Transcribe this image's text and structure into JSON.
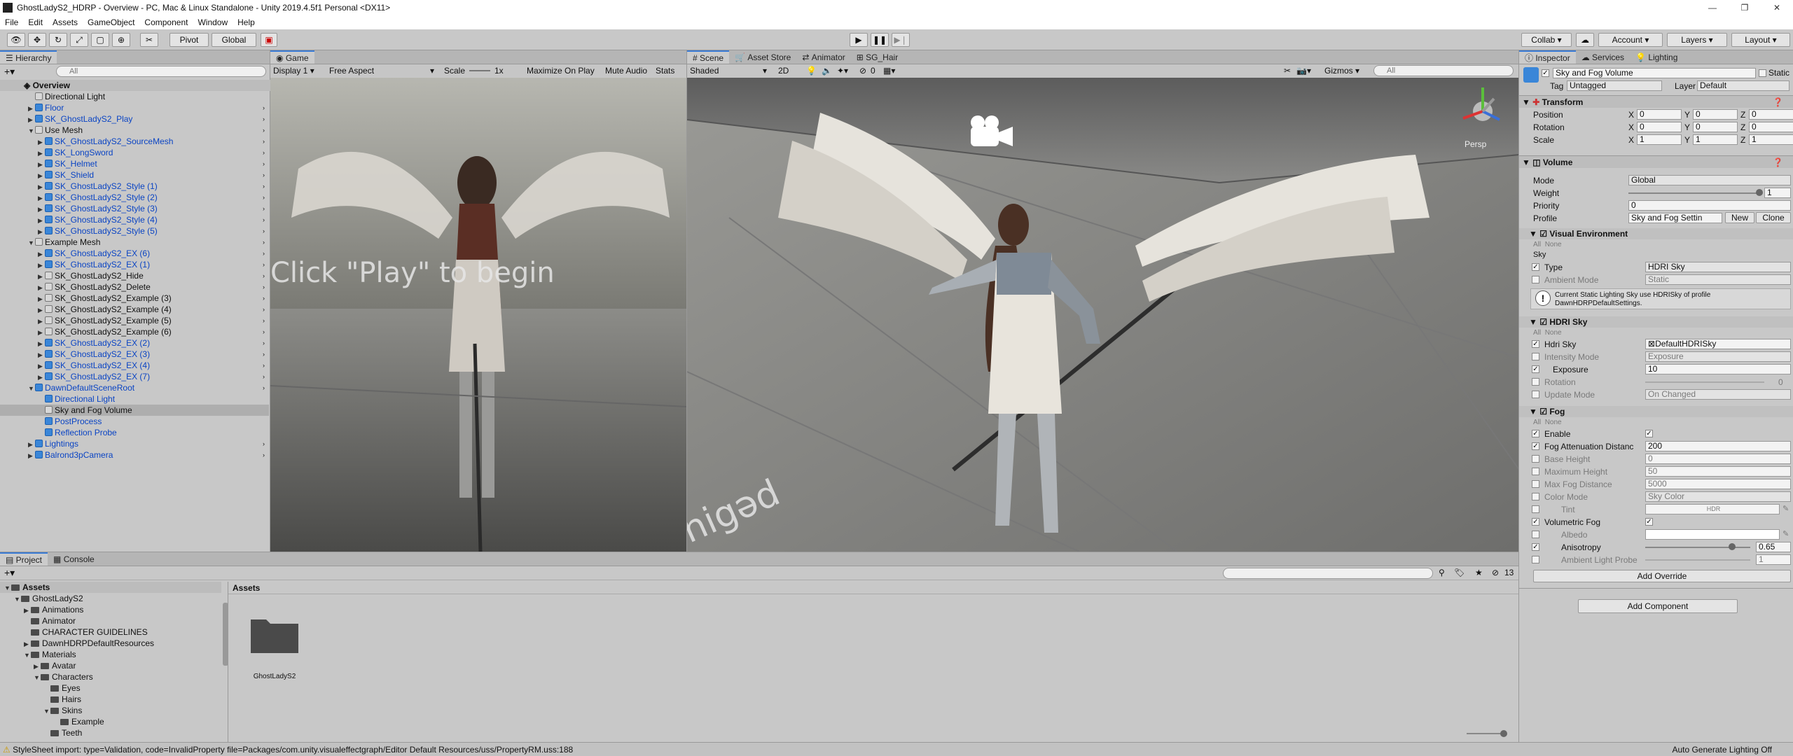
{
  "window": {
    "title": "GhostLadyS2_HDRP - Overview - PC, Mac & Linux Standalone - Unity 2019.4.5f1 Personal <DX11>"
  },
  "menu": [
    "File",
    "Edit",
    "Assets",
    "GameObject",
    "Component",
    "Window",
    "Help"
  ],
  "toolbar": {
    "pivot": "Pivot",
    "global": "Global",
    "collab": "Collab",
    "account": "Account",
    "layers": "Layers",
    "layout": "Layout"
  },
  "hierarchy": {
    "tab": "Hierarchy",
    "search_placeholder": "All",
    "scene": "Overview",
    "rows": [
      {
        "label": "Directional Light",
        "indent": 1,
        "arrow": "",
        "blue": false,
        "sel": false
      },
      {
        "label": "Floor",
        "indent": 1,
        "arrow": "▶",
        "blue": true,
        "sel": false
      },
      {
        "label": "SK_GhostLadyS2_Play",
        "indent": 1,
        "arrow": "▶",
        "blue": true,
        "sel": false
      },
      {
        "label": "Use Mesh",
        "indent": 1,
        "arrow": "▼",
        "blue": false,
        "sel": false
      },
      {
        "label": "SK_GhostLadyS2_SourceMesh",
        "indent": 2,
        "arrow": "▶",
        "blue": true,
        "sel": false
      },
      {
        "label": "SK_LongSword",
        "indent": 2,
        "arrow": "▶",
        "blue": true,
        "sel": false
      },
      {
        "label": "SK_Helmet",
        "indent": 2,
        "arrow": "▶",
        "blue": true,
        "sel": false
      },
      {
        "label": "SK_Shield",
        "indent": 2,
        "arrow": "▶",
        "blue": true,
        "sel": false
      },
      {
        "label": "SK_GhostLadyS2_Style (1)",
        "indent": 2,
        "arrow": "▶",
        "blue": true,
        "sel": false
      },
      {
        "label": "SK_GhostLadyS2_Style (2)",
        "indent": 2,
        "arrow": "▶",
        "blue": true,
        "sel": false
      },
      {
        "label": "SK_GhostLadyS2_Style (3)",
        "indent": 2,
        "arrow": "▶",
        "blue": true,
        "sel": false
      },
      {
        "label": "SK_GhostLadyS2_Style (4)",
        "indent": 2,
        "arrow": "▶",
        "blue": true,
        "sel": false
      },
      {
        "label": "SK_GhostLadyS2_Style (5)",
        "indent": 2,
        "arrow": "▶",
        "blue": true,
        "sel": false
      },
      {
        "label": "Example Mesh",
        "indent": 1,
        "arrow": "▼",
        "blue": false,
        "sel": false
      },
      {
        "label": "SK_GhostLadyS2_EX (6)",
        "indent": 2,
        "arrow": "▶",
        "blue": true,
        "sel": false
      },
      {
        "label": "SK_GhostLadyS2_EX (1)",
        "indent": 2,
        "arrow": "▶",
        "blue": true,
        "sel": false
      },
      {
        "label": "SK_GhostLadyS2_Hide",
        "indent": 2,
        "arrow": "▶",
        "blue": false,
        "sel": false
      },
      {
        "label": "SK_GhostLadyS2_Delete",
        "indent": 2,
        "arrow": "▶",
        "blue": false,
        "sel": false
      },
      {
        "label": "SK_GhostLadyS2_Example (3)",
        "indent": 2,
        "arrow": "▶",
        "blue": false,
        "sel": false
      },
      {
        "label": "SK_GhostLadyS2_Example (4)",
        "indent": 2,
        "arrow": "▶",
        "blue": false,
        "sel": false
      },
      {
        "label": "SK_GhostLadyS2_Example (5)",
        "indent": 2,
        "arrow": "▶",
        "blue": false,
        "sel": false
      },
      {
        "label": "SK_GhostLadyS2_Example (6)",
        "indent": 2,
        "arrow": "▶",
        "blue": false,
        "sel": false
      },
      {
        "label": "SK_GhostLadyS2_EX (2)",
        "indent": 2,
        "arrow": "▶",
        "blue": true,
        "sel": false
      },
      {
        "label": "SK_GhostLadyS2_EX (3)",
        "indent": 2,
        "arrow": "▶",
        "blue": true,
        "sel": false
      },
      {
        "label": "SK_GhostLadyS2_EX (4)",
        "indent": 2,
        "arrow": "▶",
        "blue": true,
        "sel": false
      },
      {
        "label": "SK_GhostLadyS2_EX (7)",
        "indent": 2,
        "arrow": "▶",
        "blue": true,
        "sel": false
      },
      {
        "label": "DawnDefaultSceneRoot",
        "indent": 1,
        "arrow": "▼",
        "blue": true,
        "sel": false
      },
      {
        "label": "Directional Light",
        "indent": 2,
        "arrow": "",
        "blue": true,
        "sel": false
      },
      {
        "label": "Sky and Fog Volume",
        "indent": 2,
        "arrow": "",
        "blue": false,
        "sel": true
      },
      {
        "label": "PostProcess",
        "indent": 2,
        "arrow": "",
        "blue": true,
        "sel": false
      },
      {
        "label": "Reflection Probe",
        "indent": 2,
        "arrow": "",
        "blue": true,
        "sel": false
      },
      {
        "label": "Lightings",
        "indent": 1,
        "arrow": "▶",
        "blue": true,
        "sel": false
      },
      {
        "label": "Balrond3pCamera",
        "indent": 1,
        "arrow": "▶",
        "blue": true,
        "sel": false
      }
    ]
  },
  "game": {
    "tab": "Game",
    "display": "Display 1",
    "aspect": "Free Aspect",
    "scale_label": "Scale",
    "scale_value": "1x",
    "maximize": "Maximize On Play",
    "mute": "Mute Audio",
    "stats": "Stats",
    "overlay_text": "Click \"Play\" to begin"
  },
  "scene": {
    "tabs": [
      "Scene",
      "Asset Store",
      "Animator",
      "SG_Hair"
    ],
    "shading": "Shaded",
    "mode2d": "2D",
    "hidden_count": "0",
    "gizmos": "Gizmos",
    "search_placeholder": "All",
    "persp": "Persp",
    "floor_text": "nigəd"
  },
  "inspector": {
    "tabs": [
      "Inspector",
      "Services",
      "Lighting"
    ],
    "object_name": "Sky and Fog Volume",
    "static_label": "Static",
    "tag_label": "Tag",
    "tag_value": "Untagged",
    "layer_label": "Layer",
    "layer_value": "Default",
    "transform": {
      "title": "Transform",
      "rows": [
        {
          "label": "Position",
          "x": "0",
          "y": "0",
          "z": "0"
        },
        {
          "label": "Rotation",
          "x": "0",
          "y": "0",
          "z": "0"
        },
        {
          "label": "Scale",
          "x": "1",
          "y": "1",
          "z": "1"
        }
      ],
      "axes": [
        "X",
        "Y",
        "Z"
      ]
    },
    "volume": {
      "title": "Volume",
      "mode_label": "Mode",
      "mode_value": "Global",
      "weight_label": "Weight",
      "weight_value": "1",
      "priority_label": "Priority",
      "priority_value": "0",
      "profile_label": "Profile",
      "profile_value": "Sky and Fog Settin",
      "new_btn": "New",
      "clone_btn": "Clone"
    },
    "visual_env": {
      "title": "Visual Environment",
      "all": "All",
      "none": "None",
      "sky_label": "Sky",
      "type_label": "Type",
      "type_value": "HDRI Sky",
      "ambient_label": "Ambient Mode",
      "ambient_value": "Static",
      "warning": "Current Static Lighting Sky use HDRISky of profile DawnHDRPDefaultSettings."
    },
    "hdri": {
      "title": "HDRI Sky",
      "all": "All",
      "none": "None",
      "hdri_label": "Hdri Sky",
      "hdri_value": "DefaultHDRISky",
      "intensity_label": "Intensity Mode",
      "intensity_value": "Exposure",
      "exposure_label": "Exposure",
      "exposure_value": "10",
      "rotation_label": "Rotation",
      "rotation_value": "0",
      "update_label": "Update Mode",
      "update_value": "On Changed"
    },
    "fog": {
      "title": "Fog",
      "all": "All",
      "none": "None",
      "enable_label": "Enable",
      "atten_label": "Fog Attenuation Distanc",
      "atten_value": "200",
      "base_label": "Base Height",
      "base_value": "0",
      "max_label": "Maximum Height",
      "max_value": "50",
      "maxdist_label": "Max Fog Distance",
      "maxdist_value": "5000",
      "color_label": "Color Mode",
      "color_value": "Sky Color",
      "tint_label": "Tint",
      "tint_value": "HDR",
      "vol_label": "Volumetric Fog",
      "albedo_label": "Albedo",
      "aniso_label": "Anisotropy",
      "aniso_value": "0.65",
      "aniso_level": 0.825,
      "probe_label": "Ambient Light Probe I",
      "probe_value": "1"
    },
    "add_override": "Add Override",
    "add_component": "Add Component"
  },
  "project": {
    "tabs": [
      "Project",
      "Console"
    ],
    "count": "13",
    "breadcrumb": "Assets",
    "tree": [
      {
        "label": "Assets",
        "indent": 0,
        "arrow": "▼",
        "bold": true
      },
      {
        "label": "GhostLadyS2",
        "indent": 1,
        "arrow": "▼",
        "bold": false
      },
      {
        "label": "Animations",
        "indent": 2,
        "arrow": "▶",
        "bold": false
      },
      {
        "label": "Animator",
        "indent": 2,
        "arrow": "",
        "bold": false
      },
      {
        "label": "CHARACTER GUIDELINES",
        "indent": 2,
        "arrow": "",
        "bold": false
      },
      {
        "label": "DawnHDRPDefaultResources",
        "indent": 2,
        "arrow": "▶",
        "bold": false
      },
      {
        "label": "Materials",
        "indent": 2,
        "arrow": "▼",
        "bold": false
      },
      {
        "label": "Avatar",
        "indent": 3,
        "arrow": "▶",
        "bold": false
      },
      {
        "label": "Characters",
        "indent": 3,
        "arrow": "▼",
        "bold": false
      },
      {
        "label": "Eyes",
        "indent": 4,
        "arrow": "",
        "bold": false
      },
      {
        "label": "Hairs",
        "indent": 4,
        "arrow": "",
        "bold": false
      },
      {
        "label": "Skins",
        "indent": 4,
        "arrow": "▼",
        "bold": false
      },
      {
        "label": "Example",
        "indent": 5,
        "arrow": "",
        "bold": false
      },
      {
        "label": "Teeth",
        "indent": 4,
        "arrow": "",
        "bold": false
      }
    ],
    "asset_name": "GhostLadyS2"
  },
  "status": {
    "message": "StyleSheet import: type=Validation, code=InvalidProperty file=Packages/com.unity.visualeffectgraph/Editor Default Resources/uss/PropertyRM.uss:188",
    "right": "Auto Generate Lighting Off"
  },
  "colors": {
    "accent": "#3a7bd5",
    "prefab_blue": "#0a44c4",
    "selection": "#aeaeae"
  }
}
